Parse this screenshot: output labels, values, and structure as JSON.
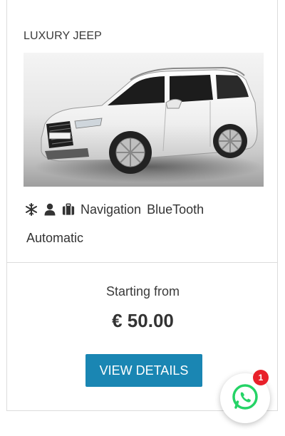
{
  "listing": {
    "title": "LUXURY JEEP",
    "image_alt": "White SUV car photo",
    "features": {
      "icons": [
        "snowflake-icon",
        "user-icon",
        "luggage-icon"
      ],
      "navigation": "Navigation",
      "bluetooth": "BlueTooth",
      "transmission": "Automatic"
    },
    "pricing": {
      "label": "Starting from",
      "price": "€ 50.00"
    },
    "cta_label": "VIEW DETAILS"
  },
  "whatsapp": {
    "badge_count": "1",
    "icon": "whatsapp-icon"
  },
  "colors": {
    "button": "#1a86b3",
    "whatsapp": "#25d366",
    "badge": "#e8202a"
  }
}
